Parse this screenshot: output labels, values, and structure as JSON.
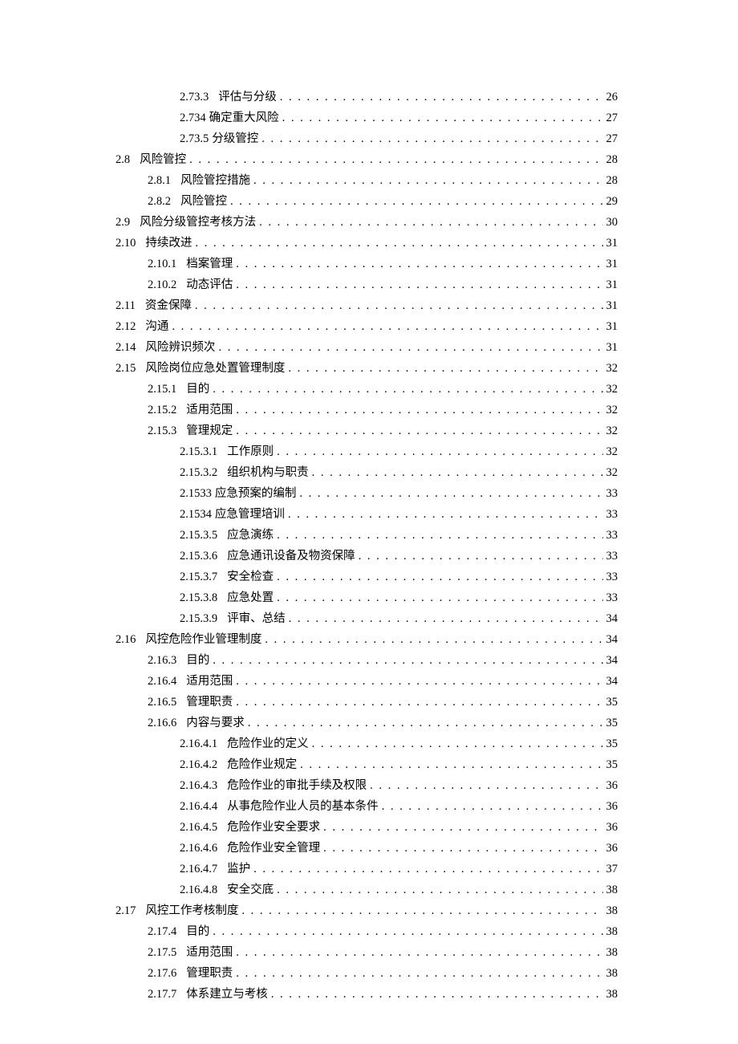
{
  "toc": [
    {
      "indent": 2,
      "num": "2.73.3",
      "title": "评估与分级",
      "page": "26"
    },
    {
      "indent": 2,
      "num": "2.734",
      "title": "确定重大风险",
      "page": "27",
      "nospace": true
    },
    {
      "indent": 2,
      "num": "2.73.5",
      "title": "分级管控",
      "page": "27",
      "nospace": true
    },
    {
      "indent": 0,
      "num": "2.8",
      "title": "风险管控",
      "page": "28"
    },
    {
      "indent": 1,
      "num": "2.8.1",
      "title": "风险管控措施",
      "page": "28"
    },
    {
      "indent": 1,
      "num": "2.8.2",
      "title": "风险管控",
      "page": "29"
    },
    {
      "indent": 0,
      "num": "2.9",
      "title": "风险分级管控考核方法",
      "page": "30"
    },
    {
      "indent": 0,
      "num": "2.10",
      "title": "持续改进",
      "page": "31"
    },
    {
      "indent": 1,
      "num": "2.10.1",
      "title": "档案管理",
      "page": "31"
    },
    {
      "indent": 1,
      "num": "2.10.2",
      "title": "动态评估",
      "page": "31"
    },
    {
      "indent": 0,
      "num": "2.11",
      "title": "资金保障",
      "page": "31"
    },
    {
      "indent": 0,
      "num": "2.12",
      "title": "沟通",
      "page": "31"
    },
    {
      "indent": 0,
      "num": "2.14",
      "title": "风险辨识频次",
      "page": "31"
    },
    {
      "indent": 0,
      "num": "2.15",
      "title": "风险岗位应急处置管理制度",
      "page": "32"
    },
    {
      "indent": 1,
      "num": "2.15.1",
      "title": "目的",
      "page": "32"
    },
    {
      "indent": 1,
      "num": "2.15.2",
      "title": "适用范围",
      "page": "32"
    },
    {
      "indent": 1,
      "num": "2.15.3",
      "title": "管理规定",
      "page": "32"
    },
    {
      "indent": 2,
      "num": "2.15.3.1",
      "title": "工作原则",
      "page": "32"
    },
    {
      "indent": 2,
      "num": "2.15.3.2",
      "title": "组织机构与职责",
      "page": "32"
    },
    {
      "indent": 2,
      "num": "2.1533",
      "title": "应急预案的编制",
      "page": "33",
      "nospace": true
    },
    {
      "indent": 2,
      "num": "2.1534",
      "title": "应急管理培训",
      "page": "33",
      "nospace": true
    },
    {
      "indent": 2,
      "num": "2.15.3.5",
      "title": "应急演练",
      "page": "33"
    },
    {
      "indent": 2,
      "num": "2.15.3.6",
      "title": "应急通讯设备及物资保障",
      "page": "33"
    },
    {
      "indent": 2,
      "num": "2.15.3.7",
      "title": "安全检查",
      "page": "33"
    },
    {
      "indent": 2,
      "num": "2.15.3.8",
      "title": "应急处置",
      "page": "33"
    },
    {
      "indent": 2,
      "num": "2.15.3.9",
      "title": "评审、总结",
      "page": "34"
    },
    {
      "indent": 0,
      "num": "2.16",
      "title": "风控危险作业管理制度",
      "page": "34"
    },
    {
      "indent": 1,
      "num": "2.16.3",
      "title": "目的",
      "page": "34"
    },
    {
      "indent": 1,
      "num": "2.16.4",
      "title": "适用范围",
      "page": "34"
    },
    {
      "indent": 1,
      "num": "2.16.5",
      "title": "管理职责",
      "page": "35"
    },
    {
      "indent": 1,
      "num": "2.16.6",
      "title": "内容与要求",
      "page": "35"
    },
    {
      "indent": 2,
      "num": "2.16.4.1",
      "title": "危险作业的定义",
      "page": "35"
    },
    {
      "indent": 2,
      "num": "2.16.4.2",
      "title": "危险作业规定",
      "page": "35"
    },
    {
      "indent": 2,
      "num": "2.16.4.3",
      "title": "危险作业的审批手续及权限",
      "page": "36"
    },
    {
      "indent": 2,
      "num": "2.16.4.4",
      "title": "从事危险作业人员的基本条件",
      "page": "36"
    },
    {
      "indent": 2,
      "num": "2.16.4.5",
      "title": "危险作业安全要求",
      "page": "36"
    },
    {
      "indent": 2,
      "num": "2.16.4.6",
      "title": "危险作业安全管理",
      "page": "36"
    },
    {
      "indent": 2,
      "num": "2.16.4.7",
      "title": "监护",
      "page": "37"
    },
    {
      "indent": 2,
      "num": "2.16.4.8",
      "title": "安全交底",
      "page": "38"
    },
    {
      "indent": 0,
      "num": "2.17",
      "title": "风控工作考核制度",
      "page": "38"
    },
    {
      "indent": 1,
      "num": "2.17.4",
      "title": "目的",
      "page": "38"
    },
    {
      "indent": 1,
      "num": "2.17.5",
      "title": "适用范围",
      "page": "38"
    },
    {
      "indent": 1,
      "num": "2.17.6",
      "title": "管理职责",
      "page": "38"
    },
    {
      "indent": 1,
      "num": "2.17.7",
      "title": "体系建立与考核",
      "page": "38"
    }
  ]
}
